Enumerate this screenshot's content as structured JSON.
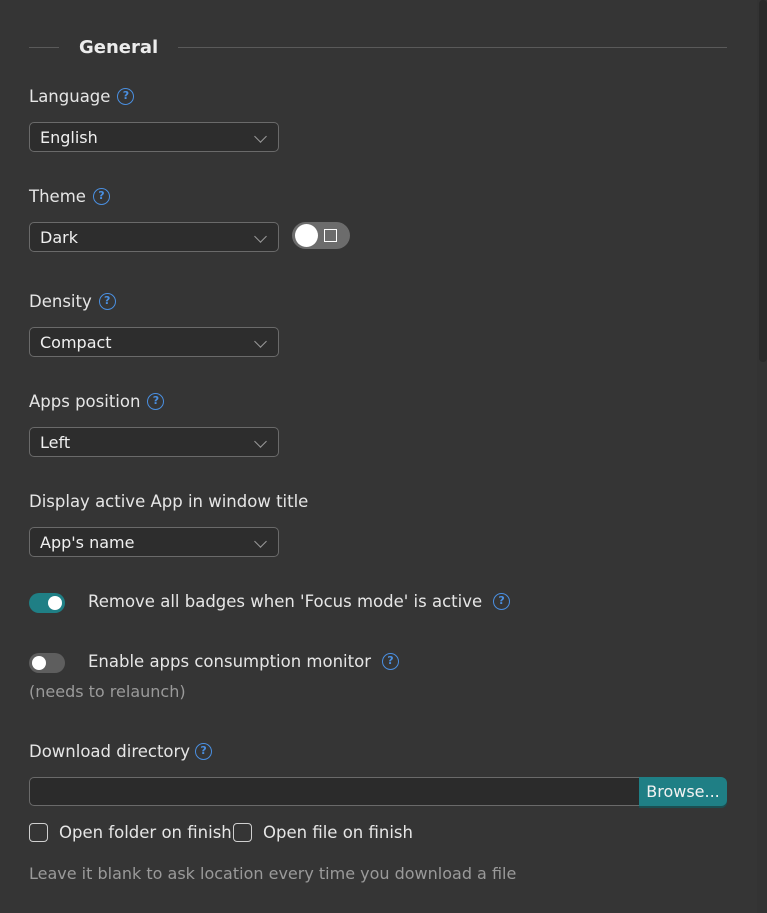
{
  "section": {
    "title": "General"
  },
  "language": {
    "label": "Language",
    "value": "English"
  },
  "theme": {
    "label": "Theme",
    "value": "Dark"
  },
  "density": {
    "label": "Density",
    "value": "Compact"
  },
  "apps_position": {
    "label": "Apps position",
    "value": "Left"
  },
  "window_title": {
    "label": "Display active App in window title",
    "value": "App's name"
  },
  "focus_badges": {
    "label": "Remove all badges when 'Focus mode' is active",
    "enabled": true
  },
  "consumption_monitor": {
    "label": "Enable apps consumption monitor",
    "note": "(needs to relaunch)",
    "enabled": false
  },
  "download": {
    "label": "Download directory",
    "value": "",
    "browse_label": "Browse...",
    "open_folder_label": "Open folder on finish",
    "open_file_label": "Open file on finish",
    "hint": "Leave it blank to ask location every time you download a file"
  },
  "help_glyph": "?",
  "colors": {
    "accent": "#1f7f85",
    "help": "#4a8fe0",
    "background": "#353535"
  }
}
